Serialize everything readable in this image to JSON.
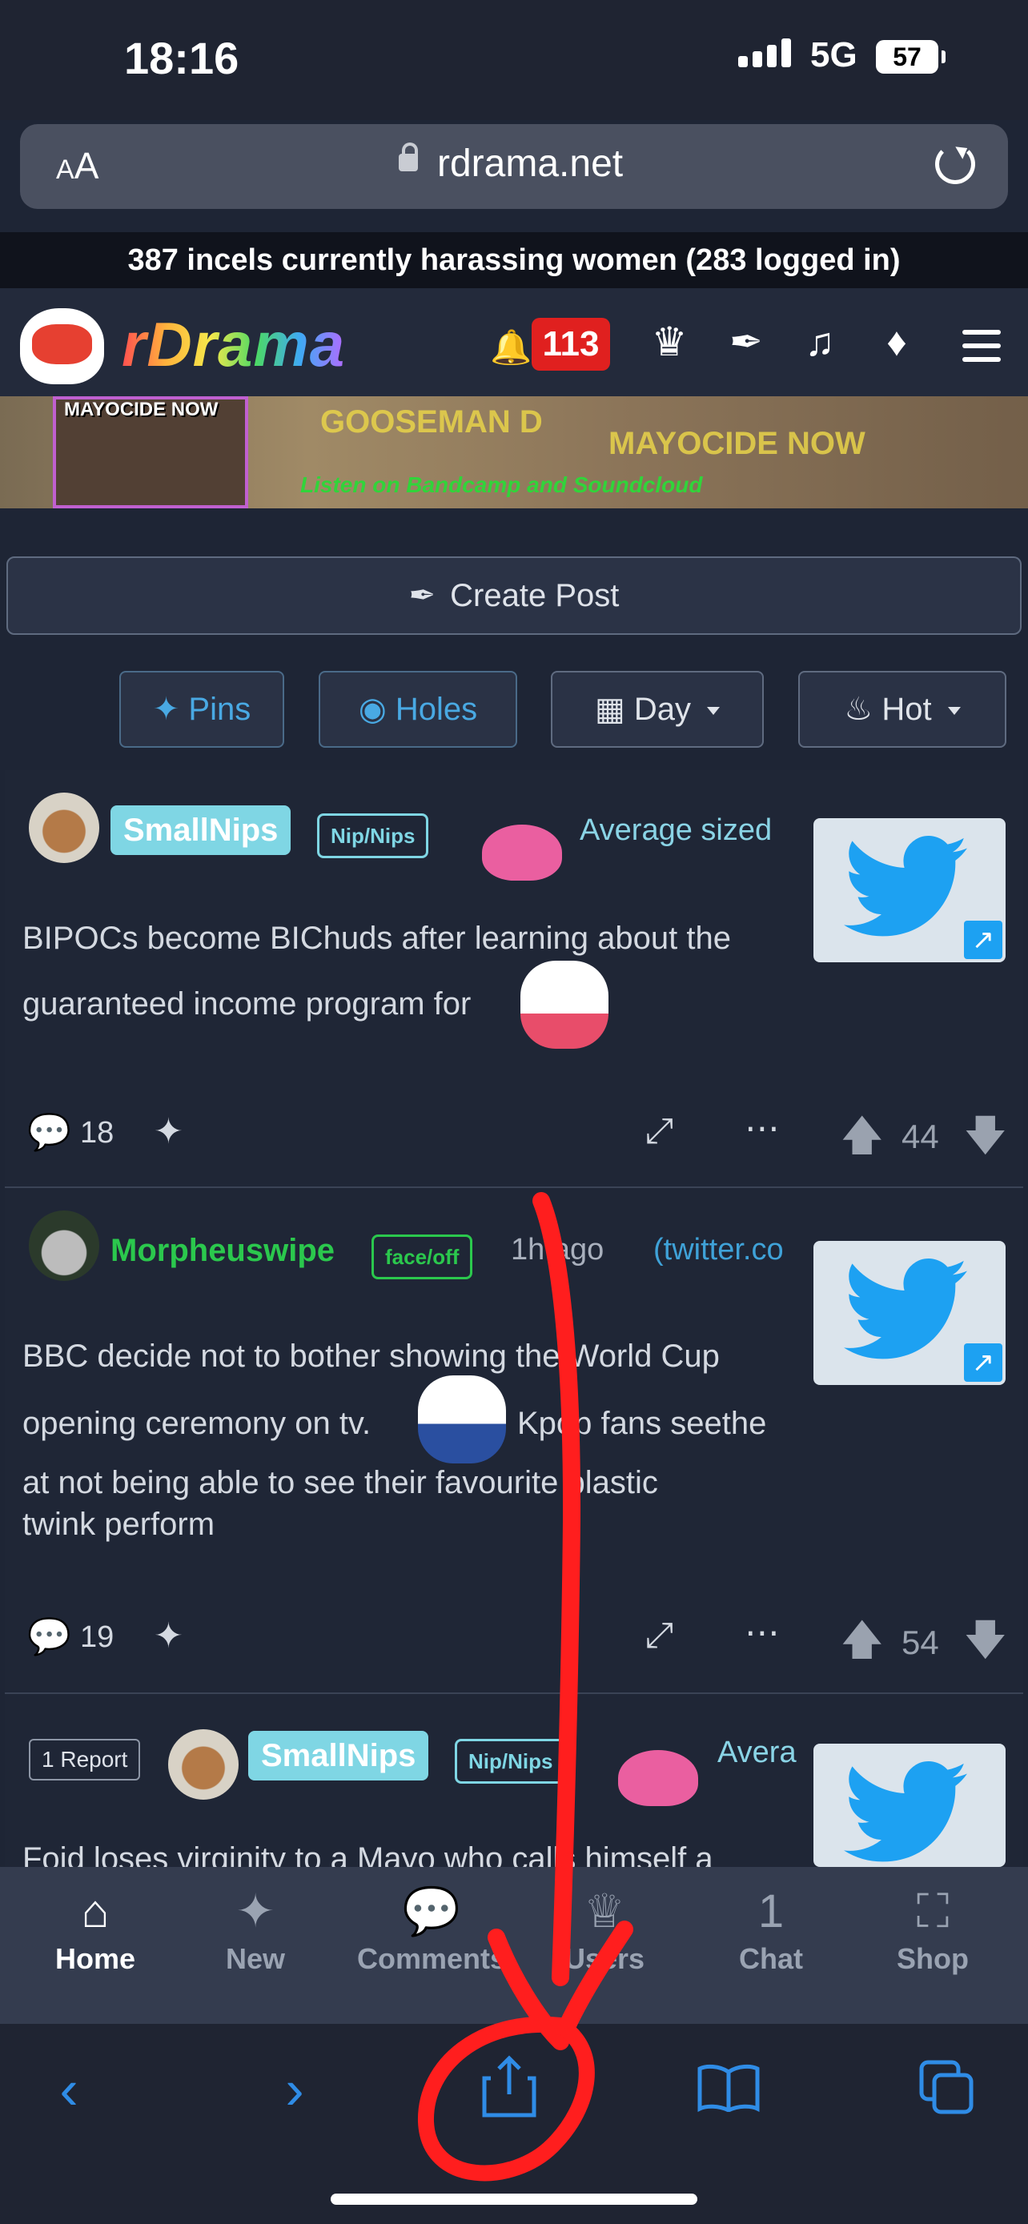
{
  "status": {
    "time": "18:16",
    "network": "5G",
    "battery": "57"
  },
  "browser": {
    "text_size": "AA",
    "domain": "rdrama.net"
  },
  "online_banner": "387 incels currently harassing women (283 logged in)",
  "header": {
    "site_name": "rDrama",
    "notifications": "113"
  },
  "ad": {
    "album_title": "MAYOCIDE NOW",
    "line1": "GOOSEMAN D",
    "line2": "MAYOCIDE NOW",
    "line3": "Listen on Bandcamp and Soundcloud"
  },
  "create_post": "Create Post",
  "filters": {
    "pins": "Pins",
    "holes": "Holes",
    "day": "Day",
    "hot": "Hot"
  },
  "posts": [
    {
      "author": "SmallNips",
      "flair": "Nip/Nips",
      "meta": "Average sized",
      "title_line1": "BIPOCs become BIChuds after learning about the",
      "title_line2": "guaranteed income program for",
      "comments": "18",
      "score": "44"
    },
    {
      "author": "Morpheuswipe",
      "flair": "face/off",
      "time": "1h ago",
      "source": "(twitter.co",
      "title_line1": "BBC decide not to bother showing the World Cup",
      "title_line2a": "opening ceremony on tv.",
      "title_line2b": "Kpop fans seethe",
      "title_line3": "at not being able to see their favourite plastic",
      "title_line4": "twink perform",
      "comments": "19",
      "score": "54"
    },
    {
      "report": "1 Report",
      "author": "SmallNips",
      "flair": "Nip/Nips",
      "meta": "Avera",
      "title_line1": "Foid loses virginity to a Mayo who calls himself a"
    }
  ],
  "bottom_nav": [
    {
      "label": "Home",
      "icon": "home-icon"
    },
    {
      "label": "New",
      "icon": "sparkles-icon"
    },
    {
      "label": "Comments",
      "icon": "comment-icon"
    },
    {
      "label": "Users",
      "icon": "trophy-icon"
    },
    {
      "label": "Chat",
      "icon": "chat-icon",
      "badge": "1"
    },
    {
      "label": "Shop",
      "icon": "store-icon"
    }
  ],
  "colors": {
    "accent_blue": "#49a9e3",
    "green": "#2bc84d",
    "badge_red": "#e0201f",
    "annotation_red": "#ff1e1e"
  }
}
